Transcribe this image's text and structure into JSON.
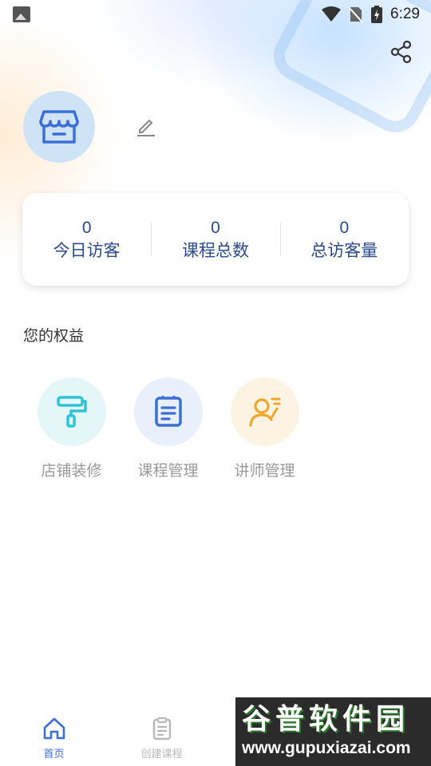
{
  "status_bar": {
    "time": "6:29"
  },
  "stats": [
    {
      "value": "0",
      "label": "今日访客"
    },
    {
      "value": "0",
      "label": "课程总数"
    },
    {
      "value": "0",
      "label": "总访客量"
    }
  ],
  "benefits": {
    "title": "您的权益",
    "items": [
      {
        "label": "店铺装修",
        "icon": "paint-roller-icon",
        "bg": "#e4f6f8",
        "color": "#2ec4d6"
      },
      {
        "label": "课程管理",
        "icon": "document-icon",
        "bg": "#e9f0fc",
        "color": "#3b6fd6"
      },
      {
        "label": "讲师管理",
        "icon": "teacher-icon",
        "bg": "#fdf3e3",
        "color": "#f0a62b"
      }
    ]
  },
  "tabbar": {
    "items": [
      {
        "label": "首页",
        "icon": "home-icon",
        "active": true
      },
      {
        "label": "创建课程",
        "icon": "clipboard-icon",
        "active": false
      }
    ],
    "active_color": "#3b6fd6",
    "inactive_color": "#b8b8b8"
  },
  "watermark": {
    "title": "谷普软件园",
    "url": "www.gupuxiazai.com"
  }
}
